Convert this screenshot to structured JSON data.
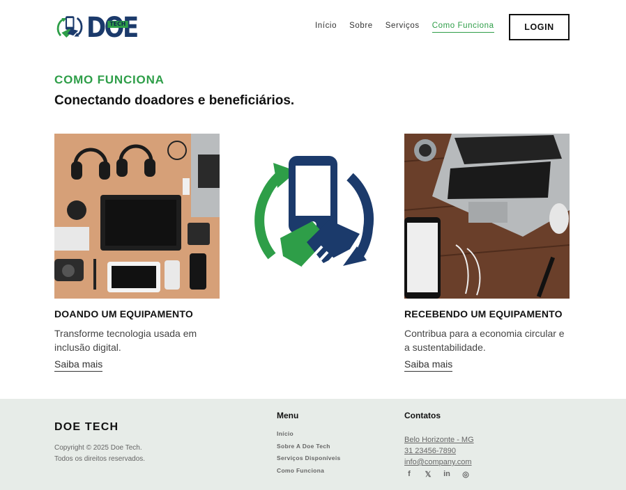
{
  "header": {
    "logo_text": "DOE",
    "logo_tag": "TECH",
    "nav": [
      {
        "label": "Início"
      },
      {
        "label": "Sobre"
      },
      {
        "label": "Serviços"
      },
      {
        "label": "Como Funciona"
      }
    ],
    "login_label": "LOGIN"
  },
  "section": {
    "kicker": "COMO FUNCIONA",
    "title": "Conectando doadores e beneficiários."
  },
  "cards": [
    {
      "title": "DOANDO UM EQUIPAMENTO",
      "text": "Transforme tecnologia usada em inclusão digital.",
      "link": "Saiba mais"
    },
    {
      "title": "RECEBENDO UM EQUIPAMENTO",
      "text": "Contribua para a economia circular e a sustentabilidade.",
      "link": "Saiba mais"
    }
  ],
  "footer": {
    "brand": "DOE TECH",
    "copyright_line1": "Copyright © 2025 Doe Tech.",
    "copyright_line2": "Todos os direitos reservados.",
    "menu_heading": "Menu",
    "menu": [
      {
        "label": "Início"
      },
      {
        "label": "Sobre A Doe Tech"
      },
      {
        "label": "Serviços Disponíveis"
      },
      {
        "label": "Como Funciona"
      }
    ],
    "contacts_heading": "Contatos",
    "contacts": [
      {
        "label": "Belo Horizonte - MG"
      },
      {
        "label": "31 23456-7890"
      },
      {
        "label": "info@company.com"
      }
    ],
    "social": [
      {
        "icon": "facebook-icon",
        "glyph": "f"
      },
      {
        "icon": "x-icon",
        "glyph": "𝕏"
      },
      {
        "icon": "linkedin-icon",
        "glyph": "in"
      },
      {
        "icon": "instagram-icon",
        "glyph": "◎"
      }
    ]
  },
  "colors": {
    "accent_green": "#2e9e48",
    "brand_navy": "#1b3a6b",
    "footer_bg": "#e7ece8"
  }
}
